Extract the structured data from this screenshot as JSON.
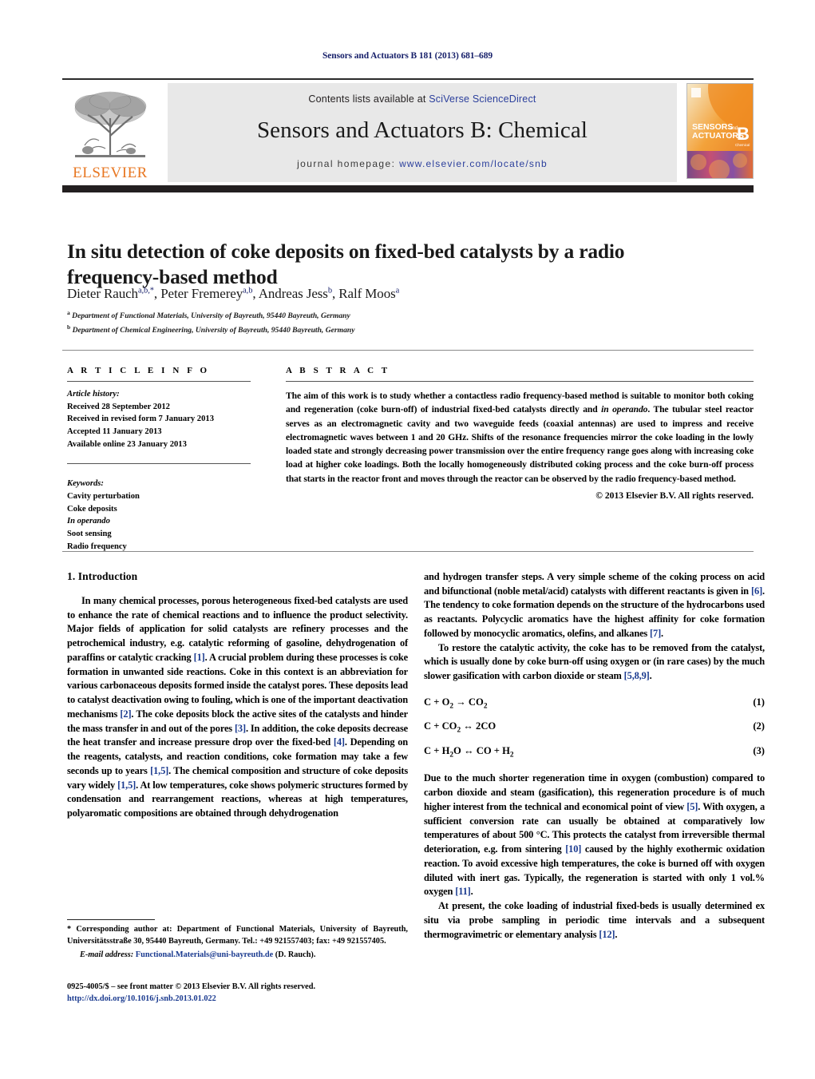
{
  "running_head": "Sensors and Actuators B 181 (2013) 681–689",
  "masthead": {
    "publisher_logo_label": "ELSEVIER",
    "contents_prefix": "Contents lists available at ",
    "contents_link": "SciVerse ScienceDirect",
    "journal_title": "Sensors and Actuators B: Chemical",
    "homepage_prefix": "journal homepage: ",
    "homepage_link": "www.elsevier.com/locate/snb",
    "cover": {
      "line1": "SENSORS",
      "line1_small": "and",
      "line2": "ACTUATORS",
      "letter": "B",
      "letter_sub": "Chemical"
    }
  },
  "article": {
    "title": "In situ detection of coke deposits on fixed-bed catalysts by a radio frequency-based method",
    "authors_html": "Dieter Rauch<sup>a,b,*</sup>, Peter Fremerey<sup>a,b</sup>, Andreas Jess<sup>b</sup>, Ralf Moos<sup>a</sup>",
    "affiliations": [
      {
        "marker": "a",
        "text": "Department of Functional Materials, University of Bayreuth, 95440 Bayreuth, Germany"
      },
      {
        "marker": "b",
        "text": "Department of Chemical Engineering, University of Bayreuth, 95440 Bayreuth, Germany"
      }
    ]
  },
  "article_info": {
    "heading": "A R T I C L E   I N F O",
    "history_label": "Article history:",
    "history": [
      "Received 28 September 2012",
      "Received in revised form 7 January 2013",
      "Accepted 11 January 2013",
      "Available online 23 January 2013"
    ],
    "keywords_label": "Keywords:",
    "keywords": [
      "Cavity perturbation",
      "Coke deposits",
      "In operando",
      "Soot sensing",
      "Radio frequency"
    ],
    "keywords_italic_index": 2
  },
  "abstract": {
    "heading": "A B S T R A C T",
    "text_parts": [
      {
        "t": "The aim of this work is to study whether a contactless radio frequency-based method is suitable to monitor both coking and regeneration (coke burn-off) of industrial fixed-bed catalysts directly and ",
        "i": false
      },
      {
        "t": "in operando",
        "i": true
      },
      {
        "t": ". The tubular steel reactor serves as an electromagnetic cavity and two waveguide feeds (coaxial antennas) are used to impress and receive electromagnetic waves between 1 and 20 GHz. Shifts of the resonance frequencies mirror the coke loading in the lowly loaded state and strongly decreasing power transmission over the entire frequency range goes along with increasing coke load at higher coke loadings. Both the locally homogeneously distributed coking process and the coke burn-off process that starts in the reactor front and moves through the reactor can be observed by the radio frequency-based method.",
        "i": false
      }
    ],
    "copyright": "© 2013 Elsevier B.V. All rights reserved."
  },
  "body": {
    "section_heading": "1.  Introduction",
    "left_paragraphs": [
      "In many chemical processes, porous heterogeneous fixed-bed catalysts are used to enhance the rate of chemical reactions and to influence the product selectivity. Major fields of application for solid catalysts are refinery processes and the petrochemical industry, e.g. catalytic reforming of gasoline, dehydrogenation of paraffins or catalytic cracking [1]. A crucial problem during these processes is coke formation in unwanted side reactions. Coke in this context is an abbreviation for various carbonaceous deposits formed inside the catalyst pores. These deposits lead to catalyst deactivation owing to fouling, which is one of the important deactivation mechanisms [2]. The coke deposits block the active sites of the catalysts and hinder the mass transfer in and out of the pores [3]. In addition, the coke deposits decrease the heat transfer and increase pressure drop over the fixed-bed [4]. Depending on the reagents, catalysts, and reaction conditions, coke formation may take a few seconds up to years [1,5]. The chemical composition and structure of coke deposits vary widely [1,5]. At low temperatures, coke shows polymeric structures formed by condensation and rearrangement reactions, whereas at high temperatures, polyaromatic compositions are obtained through dehydrogenation"
    ],
    "right_paragraphs": [
      "and hydrogen transfer steps. A very simple scheme of the coking process on acid and bifunctional (noble metal/acid) catalysts with different reactants is given in [6]. The tendency to coke formation depends on the structure of the hydrocarbons used as reactants. Polycyclic aromatics have the highest affinity for coke formation followed by monocyclic aromatics, olefins, and alkanes [7].",
      "To restore the catalytic activity, the coke has to be removed from the catalyst, which is usually done by coke burn-off using oxygen or (in rare cases) by the much slower gasification with carbon dioxide or steam [5,8,9]."
    ],
    "equations": [
      {
        "formula_html": "C + O<sub>2</sub> →  CO<sub>2</sub>",
        "number": "(1)"
      },
      {
        "formula_html": "C + CO<sub>2</sub> ↔  2CO",
        "number": "(2)"
      },
      {
        "formula_html": "C + H<sub>2</sub>O ↔ CO + H<sub>2</sub>",
        "number": "(3)"
      }
    ],
    "right_paragraphs_after_eq": [
      "Due to the much shorter regeneration time in oxygen (combustion) compared to carbon dioxide and steam (gasification), this regeneration procedure is of much higher interest from the technical and economical point of view [5]. With oxygen, a sufficient conversion rate can usually be obtained at comparatively low temperatures of about 500 °C. This protects the catalyst from irreversible thermal deterioration, e.g. from sintering [10] caused by the highly exothermic oxidation reaction. To avoid excessive high temperatures, the coke is burned off with oxygen diluted with inert gas. Typically, the regeneration is started with only 1 vol.% oxygen [11].",
      "At present, the coke loading of industrial fixed-beds is usually determined ex situ via probe sampling in periodic time intervals and a subsequent thermogravimetric or elementary analysis [12]."
    ]
  },
  "footer": {
    "corresponding_star": "*",
    "corresponding_text": " Corresponding author at: Department of Functional Materials, University of Bayreuth, Universitätsstraße 30, 95440 Bayreuth, Germany. Tel.: +49 921557403; fax: +49 921557405.",
    "email_label": "E-mail address:",
    "email_link": "Functional.Materials@uni-bayreuth.de",
    "email_suffix": " (D. Rauch).",
    "issn_line": "0925-4005/$ – see front matter © 2013 Elsevier B.V. All rights reserved.",
    "doi_line": "http://dx.doi.org/10.1016/j.snb.2013.01.022"
  },
  "colors": {
    "link": "#2b3f9c",
    "ref": "#1a3a8f",
    "elsevier_orange": "#e87722",
    "band_gray": "#e8e8e8",
    "rule_black": "#231f20",
    "runhead_navy": "#18216b"
  }
}
